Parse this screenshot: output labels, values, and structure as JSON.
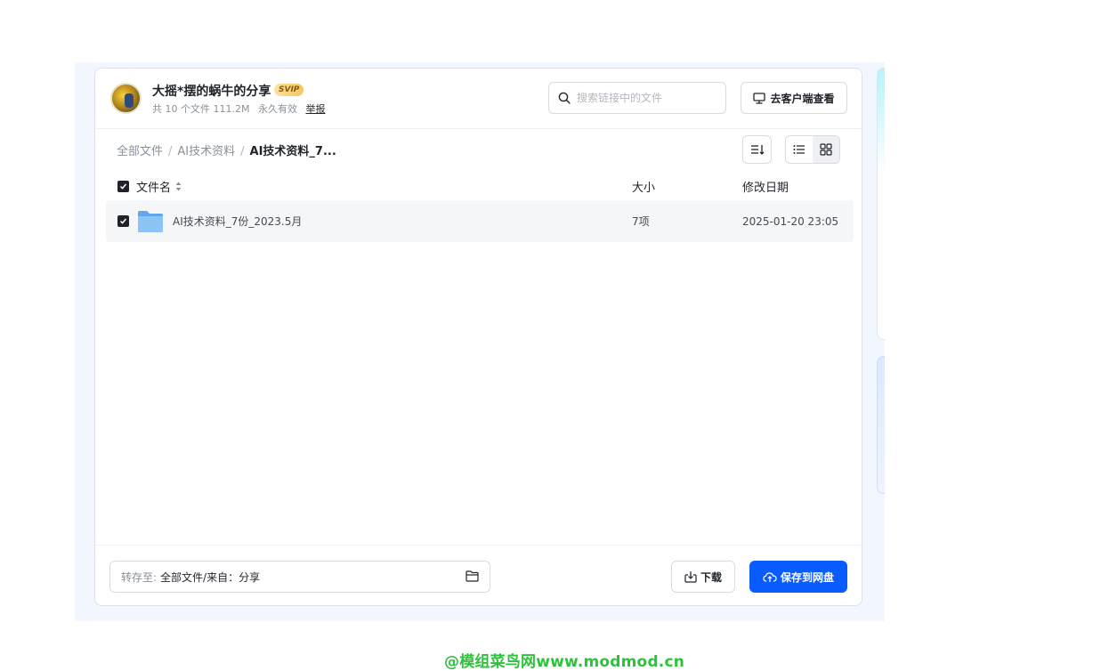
{
  "share": {
    "title": "大摇*摆的蜗牛的分享",
    "badge": "SVIP",
    "file_count": "共 10 个文件 111.2M",
    "validity": "永久有效",
    "report_label": "举报"
  },
  "search": {
    "placeholder": "搜索链接中的文件"
  },
  "client_button": "去客户端查看",
  "breadcrumb": {
    "items": [
      "全部文件",
      "AI技术资料"
    ],
    "current": "AI技术资料_7..."
  },
  "table": {
    "columns": {
      "name": "文件名",
      "size": "大小",
      "date": "修改日期"
    },
    "rows": [
      {
        "name": "AI技术资料_7份_2023.5月",
        "size": "7项",
        "date": "2025-01-20 23:05"
      }
    ]
  },
  "footer": {
    "save_to_label": "转存至:",
    "save_to_value": "全部文件/来自：分享",
    "download_label": "下载",
    "save_button": "保存到网盘"
  },
  "watermark": "@模组菜鸟网www.modmod.cn",
  "colors": {
    "accent": "#0b5cff",
    "watermark": "#2ec23c"
  }
}
